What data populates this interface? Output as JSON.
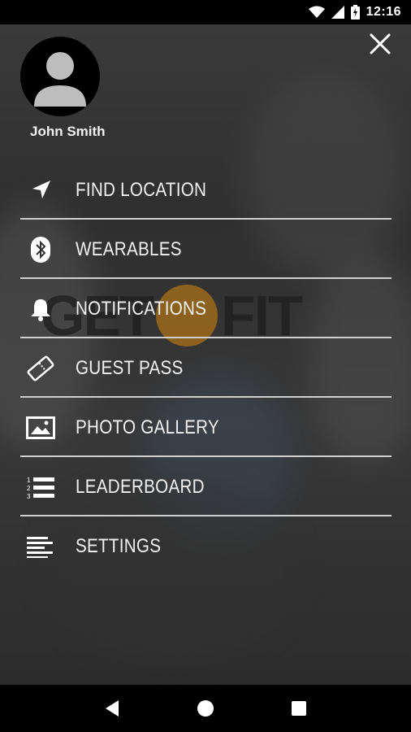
{
  "status_bar": {
    "time": "12:16",
    "icons": [
      "wifi-icon",
      "cell-signal-icon",
      "battery-icon"
    ]
  },
  "drawer": {
    "close_icon": "close-icon",
    "user": {
      "name": "John Smith",
      "avatar_icon": "person-icon"
    },
    "background_brand": [
      "GET",
      "FIT"
    ],
    "menu": [
      {
        "label": "FIND LOCATION",
        "icon": "navigation-arrow-icon"
      },
      {
        "label": "WEARABLES",
        "icon": "bluetooth-icon"
      },
      {
        "label": "NOTIFICATIONS",
        "icon": "bell-icon"
      },
      {
        "label": "GUEST PASS",
        "icon": "ticket-icon"
      },
      {
        "label": "PHOTO GALLERY",
        "icon": "image-icon"
      },
      {
        "label": "LEADERBOARD",
        "icon": "numbered-list-icon"
      },
      {
        "label": "SETTINGS",
        "icon": "align-left-icon"
      }
    ]
  },
  "nav_bar": {
    "buttons": [
      "back-icon",
      "home-icon",
      "recents-icon"
    ]
  },
  "colors": {
    "status_bar_bg": "#000000",
    "drawer_bg": "#2f2f2f",
    "divider": "#cfcfcf",
    "text": "#f1f1f1",
    "brand_accent": "#c07a12"
  }
}
